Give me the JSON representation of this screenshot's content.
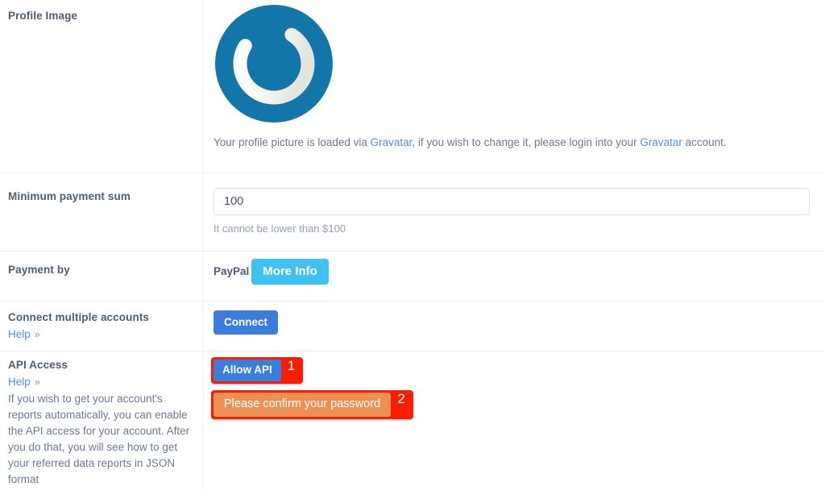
{
  "rows": {
    "profile": {
      "label": "Profile Image",
      "avatar_icon": "gravatar-logo",
      "avatar_color": "#1276a8",
      "caption_part1": "Your profile picture is loaded via ",
      "caption_link1": "Gravatar",
      "caption_part2": ", if you wish to change it, please login into your ",
      "caption_link2": "Gravatar",
      "caption_part3": " account."
    },
    "minimum_payment": {
      "label": "Minimum payment sum",
      "value": "100",
      "placeholder": "100",
      "hint": "It cannot be lower than $100"
    },
    "payment_by": {
      "label": "Payment by",
      "provider": "PayPal",
      "more_info_label": "More Info",
      "more_info_color": "#3ec1f3"
    },
    "connect_accounts": {
      "label": "Connect multiple accounts",
      "help_label": "Help",
      "help_chevron": "»",
      "connect_label": "Connect",
      "connect_color": "#3b7ddd"
    },
    "api_access": {
      "label": "API Access",
      "help_label": "Help",
      "help_chevron": "»",
      "description": "If you wish to get your account's reports automatically, you can enable the API access for your account. After you do that, you will see how to get your referred data reports in JSON format",
      "allow_api_label": "Allow API",
      "allow_api_color": "#3b7ddd",
      "confirm_password_label": "Please confirm your password",
      "confirm_password_color": "#ed9153"
    }
  },
  "annotations": {
    "color": "#f81d05",
    "items": [
      {
        "number": "1",
        "target": "Allow API"
      },
      {
        "number": "2",
        "target": "Please confirm your password"
      }
    ]
  }
}
